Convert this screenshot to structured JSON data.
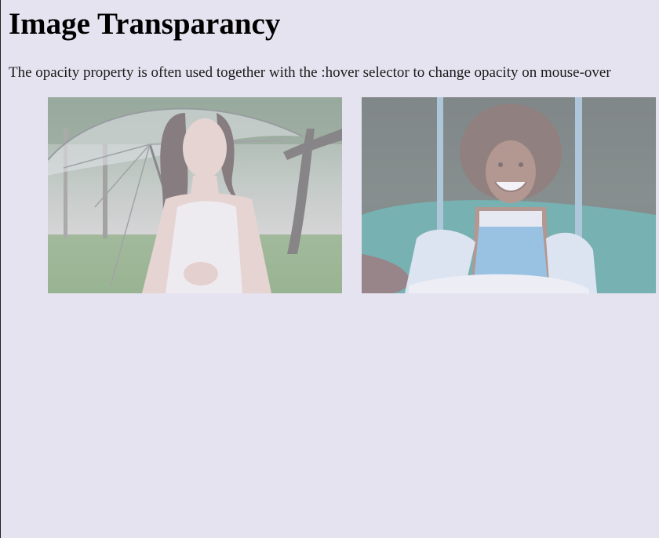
{
  "page": {
    "title": "Image Transparancy",
    "description": "The opacity property is often used together with the :hover selector to change opacity on mouse-over"
  },
  "images": [
    {
      "subject": "woman-with-umbrella"
    },
    {
      "subject": "girl-on-swing"
    }
  ]
}
